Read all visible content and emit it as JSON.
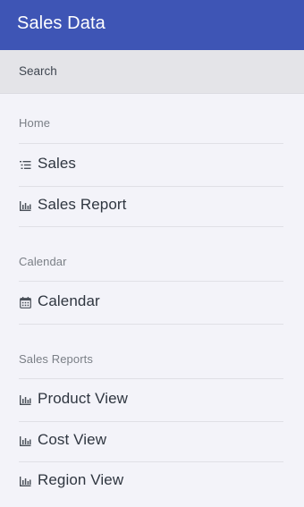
{
  "app_bar": {
    "title": "Sales Data"
  },
  "search": {
    "placeholder": "Search"
  },
  "menu": {
    "sections": [
      {
        "header": "Home",
        "items": [
          {
            "label": "Sales",
            "icon": "list-icon"
          },
          {
            "label": "Sales Report",
            "icon": "bar-chart-icon"
          }
        ]
      },
      {
        "header": "Calendar",
        "items": [
          {
            "label": "Calendar",
            "icon": "calendar-icon"
          }
        ]
      },
      {
        "header": "Sales Reports",
        "items": [
          {
            "label": "Product View",
            "icon": "bar-chart-icon"
          },
          {
            "label": "Cost View",
            "icon": "bar-chart-icon"
          },
          {
            "label": "Region View",
            "icon": "bar-chart-icon"
          }
        ]
      }
    ]
  },
  "colors": {
    "app_bar_background": "#3e55b5",
    "app_bar_text": "#ffffff",
    "search_background": "#e4e4e8",
    "menu_background": "#f3f3f9",
    "section_header_text": "#7a7f86",
    "item_text": "#2f3640",
    "divider": "#e0e0e6"
  }
}
